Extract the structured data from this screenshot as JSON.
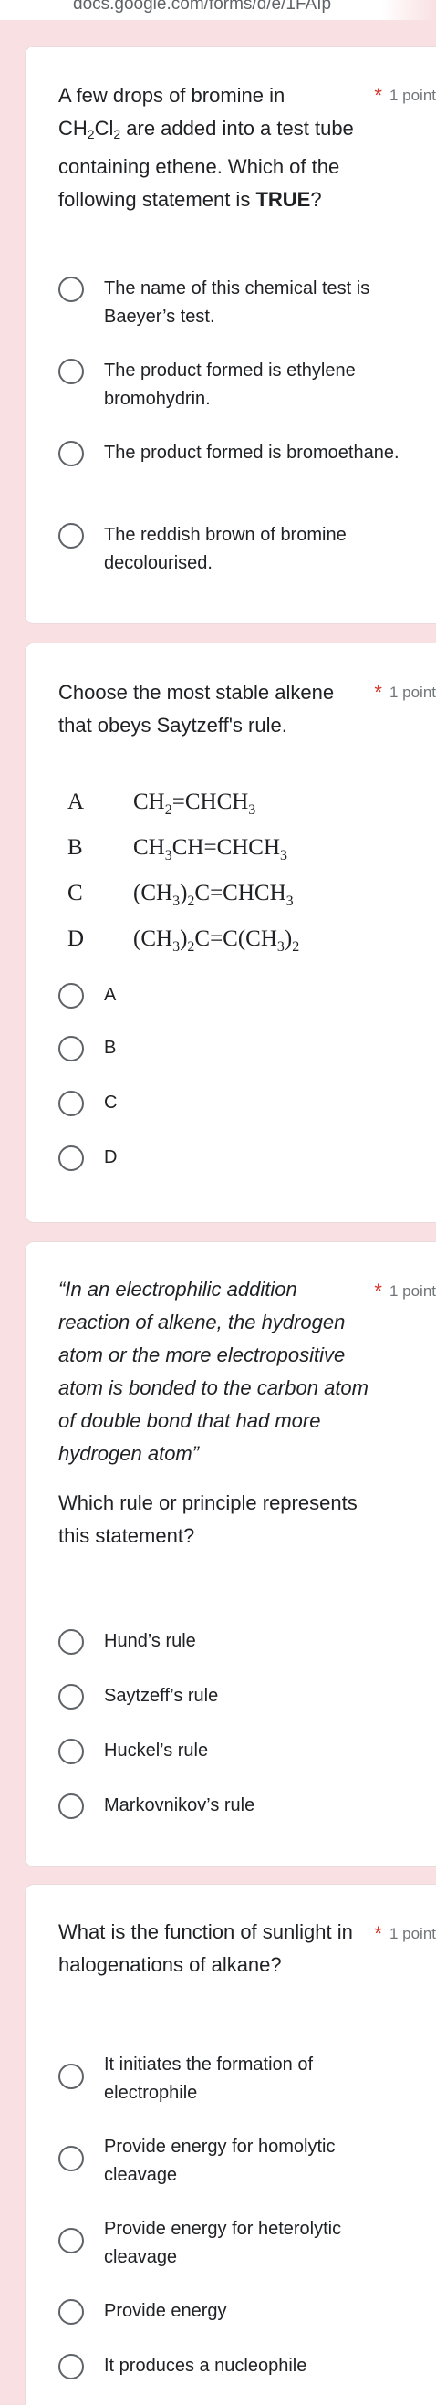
{
  "browser": {
    "url": "docs.google.com/forms/d/e/1FAIp"
  },
  "points_label": "1 point",
  "required_mark": "*",
  "questions": [
    {
      "title_prefix": "A few drops of bromine in",
      "title_formula": [
        "CH",
        "2",
        "Cl",
        "2"
      ],
      "title_rest": " are added into a test tube containing ethene.  Which of the following statement is ",
      "title_strong": "TRUE",
      "title_end": "?",
      "options": [
        "The name of this chemical test is Baeyer’s test.",
        "The product formed is ethylene bromohydrin.",
        "The product formed is bromoethane.",
        "The reddish brown of bromine decolourised."
      ]
    },
    {
      "title": "Choose the most stable alkene that obeys Saytzeff's rule.",
      "table": [
        {
          "letter": "A",
          "formula": [
            "CH",
            "2",
            "=CHCH",
            "3",
            ""
          ]
        },
        {
          "letter": "B",
          "formula": [
            "CH",
            "3",
            "CH=CHCH",
            "3",
            ""
          ]
        },
        {
          "letter": "C",
          "formula": [
            "(CH",
            "3",
            ")",
            "2",
            "C=CHCH",
            "3",
            ""
          ]
        },
        {
          "letter": "D",
          "formula": [
            "(CH",
            "3",
            ")",
            "2",
            "C=C(CH",
            "3",
            ")",
            "2",
            ""
          ]
        }
      ],
      "options": [
        "A",
        "B",
        "C",
        "D"
      ]
    },
    {
      "quote": "“In an electrophilic addition reaction of alkene, the hydrogen atom or the more electropositive atom is bonded to the carbon atom of double bond that had more hydrogen atom”",
      "title": "Which rule or principle represents this statement?",
      "options": [
        "Hund’s rule",
        "Saytzeff’s rule",
        "Huckel’s rule",
        "Markovnikov’s rule"
      ]
    },
    {
      "title": "What is the function of sunlight in halogenations of alkane?",
      "options": [
        "It initiates the formation of electrophile",
        "Provide energy for homolytic cleavage",
        "Provide energy for heterolytic cleavage",
        "Provide energy",
        "It produces a nucleophile"
      ]
    }
  ]
}
